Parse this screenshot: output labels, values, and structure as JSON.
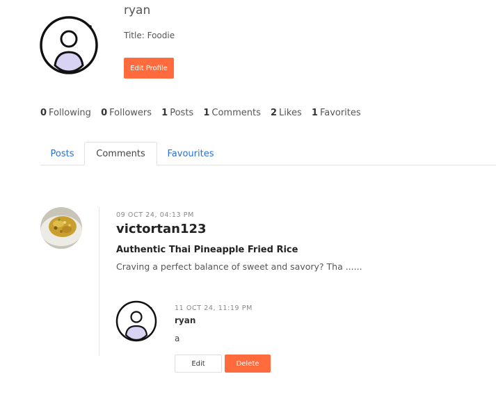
{
  "profile": {
    "username": "ryan",
    "title_label": "Title:",
    "title_value": "Foodie",
    "edit_profile_label": "Edit Profile",
    "avatar_icon": "user-avatar-icon",
    "accent_color": "#ff6b3d"
  },
  "stats": [
    {
      "count": "0",
      "label": "Following"
    },
    {
      "count": "0",
      "label": "Followers"
    },
    {
      "count": "1",
      "label": "Posts"
    },
    {
      "count": "1",
      "label": "Comments"
    },
    {
      "count": "2",
      "label": "Likes"
    },
    {
      "count": "1",
      "label": "Favorites"
    }
  ],
  "tabs": [
    {
      "label": "Posts",
      "active": false
    },
    {
      "label": "Comments",
      "active": true
    },
    {
      "label": "Favourites",
      "active": false
    }
  ],
  "comment": {
    "date": "09 OCT 24, 04:13 PM",
    "post_author": "victortan123",
    "post_title": "Authentic Thai Pineapple Fried Rice",
    "post_excerpt": "Craving a perfect balance of sweet and savory? Tha ......",
    "post_image": "fried-rice-thumbnail"
  },
  "reply": {
    "date": "11 OCT 24, 11:19 PM",
    "author": "ryan",
    "text": "a",
    "edit_label": "Edit",
    "delete_label": "Delete"
  }
}
